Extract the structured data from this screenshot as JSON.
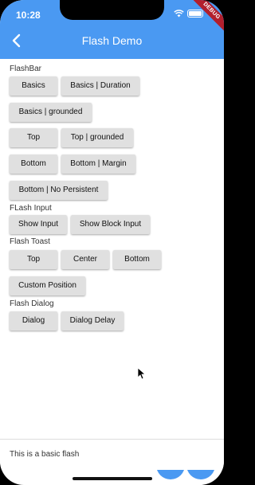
{
  "status": {
    "time": "10:28",
    "debug": "DEBUG"
  },
  "appbar": {
    "title": "Flash Demo"
  },
  "sections": {
    "flashbar": "FlashBar",
    "flash_input": "FLash Input",
    "flash_toast": "Flash Toast",
    "flash_dialog": "Flash Dialog"
  },
  "buttons": {
    "basics": "Basics",
    "basics_duration": "Basics | Duration",
    "basics_grounded": "Basics | grounded",
    "top": "Top",
    "top_grounded": "Top | grounded",
    "bottom": "Bottom",
    "bottom_margin": "Bottom | Margin",
    "bottom_no_persistent": "Bottom | No Persistent",
    "show_input": "Show Input",
    "show_block_input": "Show Block Input",
    "toast_top": "Top",
    "toast_center": "Center",
    "toast_bottom": "Bottom",
    "custom_position": "Custom Position",
    "dialog": "Dialog",
    "dialog_delay": "Dialog Delay"
  },
  "flash": {
    "message": "This is a basic flash"
  },
  "colors": {
    "primary": "#4a99f2",
    "button": "#e0e0e0",
    "debug": "#b21f2d"
  }
}
